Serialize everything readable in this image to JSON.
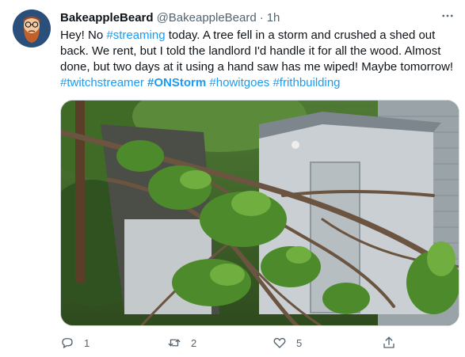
{
  "user": {
    "display_name": "BakeappleBeard",
    "handle": "@BakeappleBeard",
    "separator": "·",
    "time": "1h"
  },
  "tweet": {
    "text_parts": {
      "p1": "Hey! No ",
      "tag_streaming": "#streaming",
      "p2": " today. A tree fell in a storm and crushed a shed out back. We rent, but I told the landlord I'd handle it for all the wood. Almost done, but two days at it using a hand saw has me wiped! Maybe tomorrow!",
      "tag_twitchstreamer": "#twitchstreamer",
      "tag_onstorm": "#ONStorm",
      "tag_howitgoes": "#howitgoes",
      "tag_frithbuilding": "#frithbuilding"
    }
  },
  "actions": {
    "reply_count": "1",
    "retweet_count": "2",
    "like_count": "5",
    "reply_icon": "reply-icon",
    "retweet_icon": "retweet-icon",
    "like_icon": "heart-icon",
    "share_icon": "share-icon"
  },
  "colors": {
    "link": "#1d9bf0",
    "secondary_text": "#536471",
    "avatar_bg": "#2a4f7a"
  }
}
